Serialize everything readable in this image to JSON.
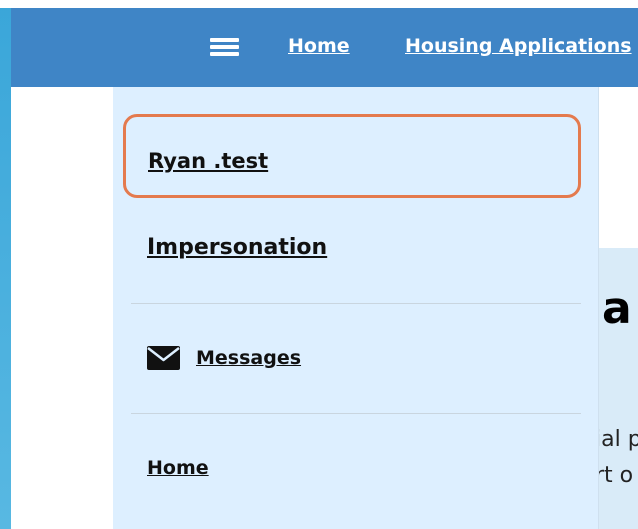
{
  "topbar": {
    "menu_icon": "hamburger-menu-icon",
    "nav": {
      "home_label": "Home",
      "housing_label": "Housing Applications"
    }
  },
  "dropdown": {
    "user_name": "Ryan .test",
    "impersonation_label": "Impersonation",
    "messages": {
      "icon": "envelope-icon",
      "label": "Messages"
    },
    "home_label": "Home"
  },
  "content": {
    "heading_fragment": "a",
    "line1_fragment": "ial p",
    "line2_fragment": "rt o"
  },
  "colors": {
    "topbar_bg": "#3f85c6",
    "dropdown_bg": "#ddefff",
    "highlight_border": "#e47a4e"
  }
}
